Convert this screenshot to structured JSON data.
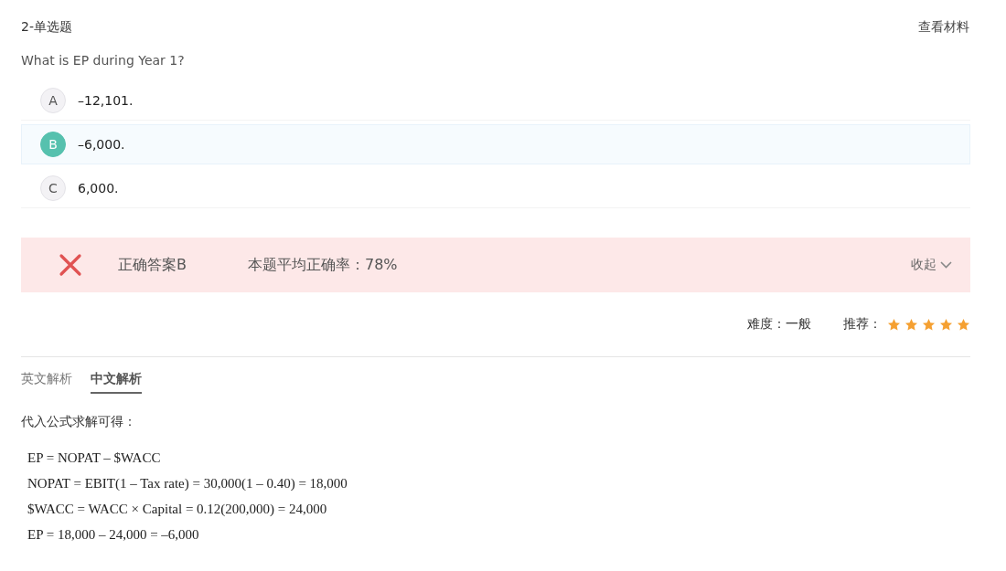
{
  "header": {
    "title": "2-单选题",
    "material_link": "查看材料"
  },
  "question": "What is EP during Year 1?",
  "options": [
    {
      "letter": "A",
      "text": "–12,101.",
      "selected": false
    },
    {
      "letter": "B",
      "text": "–6,000.",
      "selected": true
    },
    {
      "letter": "C",
      "text": "6,000.",
      "selected": false
    }
  ],
  "result": {
    "kind": "wrong",
    "correct_answer": "正确答案B",
    "average_rate": "本题平均正确率：78%",
    "collapse": "收起"
  },
  "rating": {
    "difficulty": "难度：一般",
    "recommend_label": "推荐：",
    "stars": 5
  },
  "tabs": [
    {
      "label": "英文解析",
      "selected": false
    },
    {
      "label": "中文解析",
      "selected": true
    }
  ],
  "explanation": {
    "intro": "代入公式求解可得：",
    "formulas": [
      "EP = NOPAT – $WACC",
      "NOPAT = EBIT(1 – Tax rate) = 30,000(1 – 0.40) = 18,000",
      "$WACC = WACC × Capital = 0.12(200,000) = 24,000",
      "EP = 18,000 – 24,000 = –6,000"
    ]
  }
}
